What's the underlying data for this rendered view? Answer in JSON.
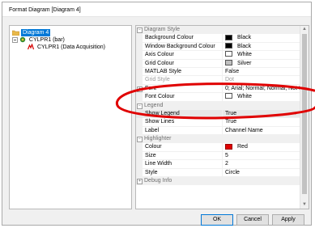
{
  "window": {
    "title": "Format Diagram [Diagram 4]"
  },
  "tree": {
    "items": [
      {
        "label": "Diagram 4",
        "icon": "folder-icon",
        "selected": true
      },
      {
        "label": "CYLPR1 (bar)",
        "icon": "bar-chart-icon",
        "selected": false
      },
      {
        "label": "CYLPR1 (Data Acquisition)",
        "icon": "data-acquisition-icon",
        "selected": false
      }
    ]
  },
  "property_grid": {
    "categories": {
      "diagram_style": "Diagram Style",
      "legend": "Legend",
      "highlighter": "Highlighter",
      "debug_info": "Debug Info"
    },
    "rows": {
      "background_colour": {
        "name": "Background Colour",
        "value": "Black",
        "swatch": "#000000"
      },
      "window_background_colour": {
        "name": "Window Background Colour",
        "value": "Black",
        "swatch": "#000000"
      },
      "axis_colour": {
        "name": "Axis Colour",
        "value": "White",
        "swatch": "#ffffff"
      },
      "grid_colour": {
        "name": "Grid Colour",
        "value": "Silver",
        "swatch": "#c0c0c0"
      },
      "matlab_style": {
        "name": "MATLAB Style",
        "value": "False"
      },
      "grid_style": {
        "name": "Grid Style",
        "value": "Dot"
      },
      "font": {
        "name": "Font",
        "value": "0; Arial; Normal; Normal; Not I"
      },
      "font_colour": {
        "name": "Font Colour",
        "value": "White",
        "swatch": "#ffffff"
      },
      "show_legend": {
        "name": "Show Legend",
        "value": "True"
      },
      "show_lines": {
        "name": "Show Lines",
        "value": "True"
      },
      "label": {
        "name": "Label",
        "value": "Channel Name"
      },
      "colour": {
        "name": "Colour",
        "value": "Red",
        "swatch": "#e00000"
      },
      "size": {
        "name": "Size",
        "value": "5"
      },
      "line_width": {
        "name": "Line Width",
        "value": "2"
      },
      "style": {
        "name": "Style",
        "value": "Circle"
      }
    }
  },
  "buttons": {
    "ok": "OK",
    "cancel": "Cancel",
    "apply": "Apply"
  },
  "colors": {
    "annotation_ring": "#e00000",
    "selection": "#0078d7"
  }
}
